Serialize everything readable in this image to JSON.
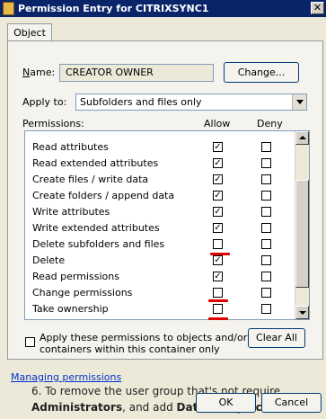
{
  "window": {
    "title": "Permission Entry for CITRIXSYNC1",
    "close_glyph": "✕"
  },
  "tabs": [
    {
      "label": "Object"
    }
  ],
  "name_label": "Name:",
  "name_value": "CREATOR OWNER",
  "change_button": "Change...",
  "apply_to_label": "Apply to:",
  "apply_to_value": "Subfolders and files only",
  "permissions_label": "Permissions:",
  "columns": {
    "allow": "Allow",
    "deny": "Deny"
  },
  "permissions": [
    {
      "name": "Read attributes",
      "allow": true,
      "deny": false
    },
    {
      "name": "Read extended attributes",
      "allow": true,
      "deny": false
    },
    {
      "name": "Create files / write data",
      "allow": true,
      "deny": false
    },
    {
      "name": "Create folders / append data",
      "allow": true,
      "deny": false
    },
    {
      "name": "Write attributes",
      "allow": true,
      "deny": false
    },
    {
      "name": "Write extended attributes",
      "allow": true,
      "deny": false
    },
    {
      "name": "Delete subfolders and files",
      "allow": false,
      "deny": false
    },
    {
      "name": "Delete",
      "allow": true,
      "deny": false
    },
    {
      "name": "Read permissions",
      "allow": true,
      "deny": false
    },
    {
      "name": "Change permissions",
      "allow": false,
      "deny": false
    },
    {
      "name": "Take ownership",
      "allow": false,
      "deny": false
    }
  ],
  "apply_checkbox_label_line1": "Apply these permissions to objects and/or",
  "apply_checkbox_label_line2": "containers within this container only",
  "clear_all_button": "Clear All",
  "managing_link": "Managing permissions",
  "ok_button": "OK",
  "cancel_button": "Cancel",
  "background_text": {
    "line1": "6. To remove the user group that's not require",
    "line2_bold1": "Administrators",
    "line2_mid": ", and add ",
    "line2_bold2": "Data Proxy Acco"
  },
  "colors": {
    "title_bg": "#0a246a",
    "annotation_red": "#e00000",
    "link": "#0033cc"
  }
}
